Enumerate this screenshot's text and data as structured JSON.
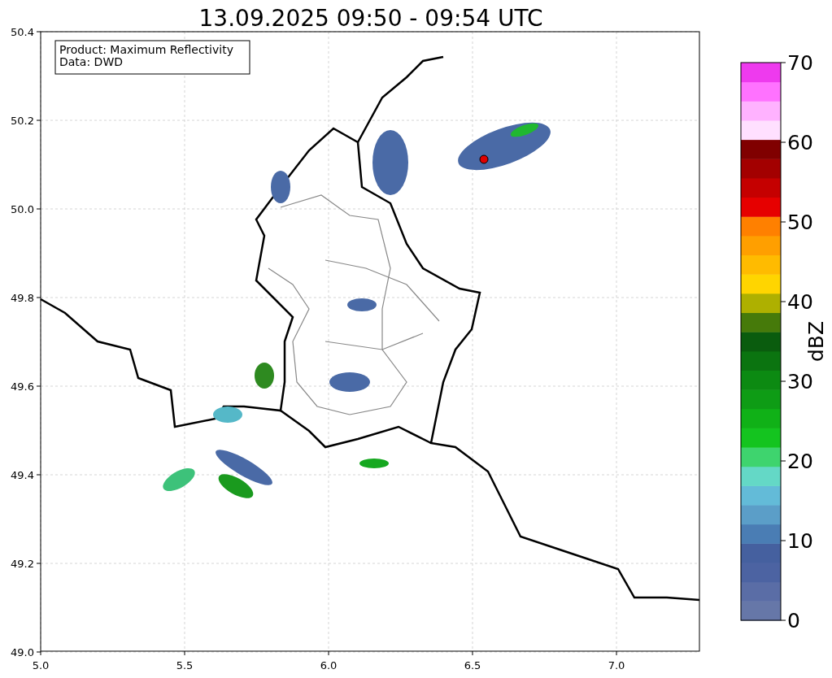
{
  "title": "13.09.2025 09:50 - 09:54 UTC",
  "legend": [
    "Product: Maximum Reflectivity",
    "Data: DWD"
  ],
  "x_axis": {
    "ticks": [
      "5.0",
      "5.5",
      "6.0",
      "6.5",
      "7.0"
    ]
  },
  "y_axis": {
    "ticks": [
      "50.4",
      "50.2",
      "50.0",
      "49.8",
      "49.6",
      "49.4",
      "49.2",
      "49.0"
    ]
  },
  "colorbar": {
    "label": "dBZ",
    "ticks": [
      "70",
      "60",
      "50",
      "40",
      "30",
      "20",
      "10",
      "0"
    ],
    "segments": [
      {
        "color": "#6677a8"
      },
      {
        "color": "#5a6da6"
      },
      {
        "color": "#4c63a2"
      },
      {
        "color": "#45609f"
      },
      {
        "color": "#4a7db4"
      },
      {
        "color": "#5b9ec8"
      },
      {
        "color": "#63bbd8"
      },
      {
        "color": "#64d8c6"
      },
      {
        "color": "#3ed46e"
      },
      {
        "color": "#14c41f"
      },
      {
        "color": "#10b117"
      },
      {
        "color": "#0e9c15"
      },
      {
        "color": "#0c8a12"
      },
      {
        "color": "#0b7410"
      },
      {
        "color": "#0a5c0e"
      },
      {
        "color": "#467a0a"
      },
      {
        "color": "#aeb000"
      },
      {
        "color": "#ffd500"
      },
      {
        "color": "#ffbb00"
      },
      {
        "color": "#ff9f00"
      },
      {
        "color": "#ff8000"
      },
      {
        "color": "#e60000"
      },
      {
        "color": "#c50000"
      },
      {
        "color": "#a30000"
      },
      {
        "color": "#800000"
      },
      {
        "color": "#ffe0ff"
      },
      {
        "color": "#ffb2ff"
      },
      {
        "color": "#ff72ff"
      },
      {
        "color": "#ee3aee"
      }
    ]
  }
}
